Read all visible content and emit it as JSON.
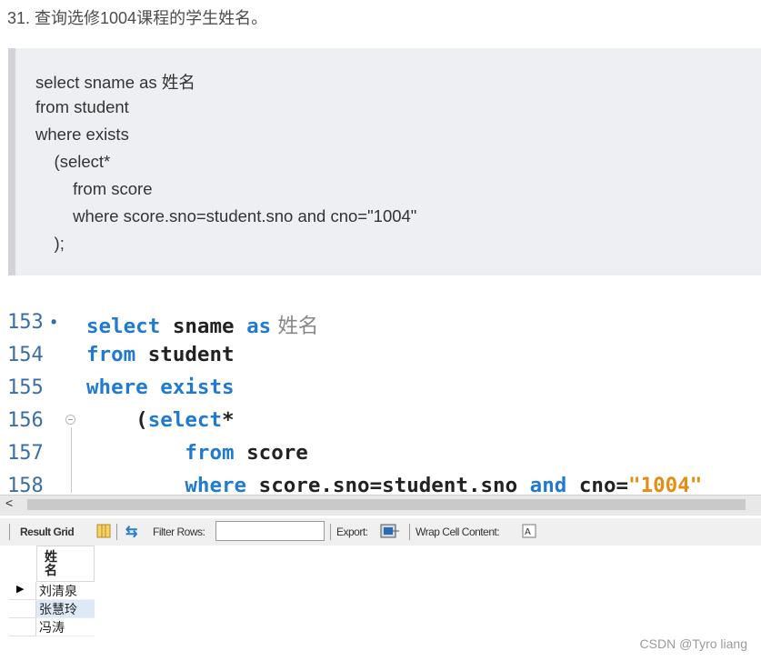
{
  "question": {
    "text": "31. 查询选修1004课程的学生姓名。"
  },
  "code_box": {
    "lines": [
      "select sname as 姓名",
      "from student",
      "where exists",
      "    (select*",
      "        from score",
      "        where score.sno=student.sno and cno=\"1004\"",
      "    );"
    ]
  },
  "editor": {
    "line_numbers": [
      "153",
      "154",
      "155",
      "156",
      "157",
      "158"
    ],
    "lines": [
      {
        "kw1": "select",
        "t1": " sname ",
        "kw2": "as",
        "cjk": " 姓名"
      },
      {
        "kw1": "from",
        "t1": " student"
      },
      {
        "kw1": "where",
        "t1": " ",
        "kw2": "exists"
      },
      {
        "t0": "    (",
        "kw1": "select",
        "t1": "*"
      },
      {
        "t0": "        ",
        "kw1": "from",
        "t1": " score"
      },
      {
        "t0": "        ",
        "kw1": "where",
        "t1": " score.sno=student.sno ",
        "kw2": "and",
        "t2": " cno=",
        "str": "\"1004\""
      }
    ]
  },
  "result_toolbar": {
    "result_grid_label": "Result Grid",
    "filter_rows_label": "Filter Rows:",
    "filter_rows_value": "",
    "export_label": "Export:",
    "wrap_cell_label": "Wrap Cell Content:"
  },
  "result_grid": {
    "column": "姓名",
    "rows": [
      "刘清泉",
      "张慧玲",
      "冯涛"
    ],
    "selected_row_index": 1
  },
  "watermark": "CSDN @Tyro liang",
  "colors": {
    "keyword": "#1f7ad0",
    "string": "#e58e13",
    "line_number": "#3a6ea8"
  }
}
